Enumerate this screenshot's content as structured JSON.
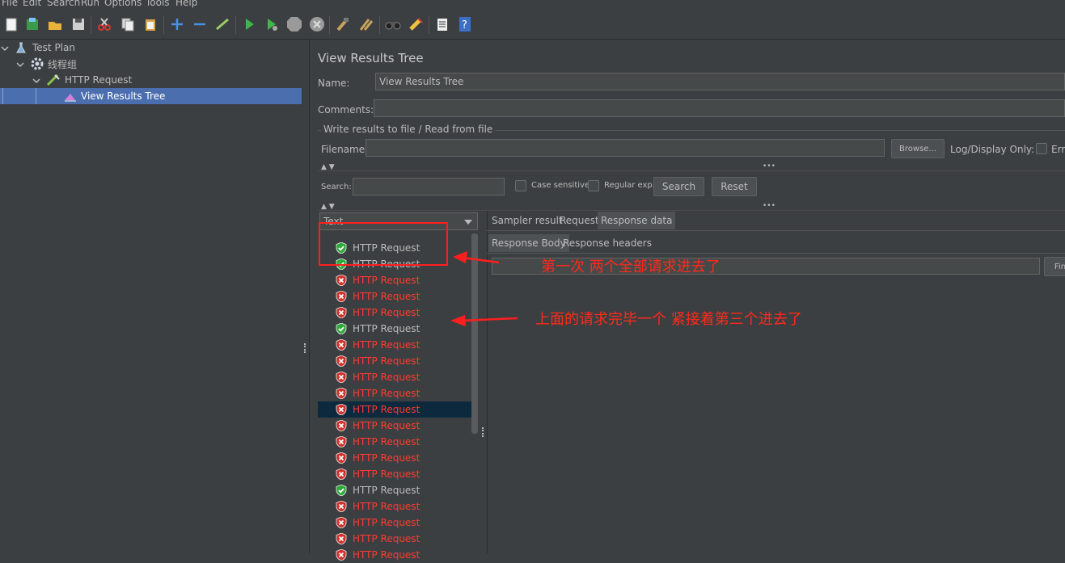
{
  "menu": [
    "File",
    "Edit",
    "Search",
    "Run",
    "Options",
    "Tools",
    "Help"
  ],
  "toolbar": {
    "icons": [
      "new-icon",
      "templates-icon",
      "open-icon",
      "save-icon",
      "cut-icon",
      "copy-icon",
      "paste-icon",
      "expand-icon",
      "collapse-icon",
      "toggle-icon",
      "start-icon",
      "start-no-pause-icon",
      "stop-icon",
      "shutdown-icon",
      "clear-icon",
      "clear-all-icon",
      "search-icon",
      "reset-search-icon",
      "function-helper-icon",
      "help-icon"
    ]
  },
  "tree": {
    "items": [
      {
        "label": "Test Plan",
        "icon": "flask-icon"
      },
      {
        "label": "线程组",
        "icon": "gear-icon"
      },
      {
        "label": "HTTP Request",
        "icon": "pipette-icon"
      },
      {
        "label": "View Results Tree",
        "icon": "chart-icon"
      }
    ]
  },
  "panel": {
    "title": "View Results Tree",
    "name_label": "Name:",
    "name_value": "View Results Tree",
    "comments_label": "Comments:",
    "comments_value": "",
    "file_group_label": "Write results to file / Read from file",
    "filename_label": "Filename",
    "filename_value": "",
    "browse_label": "Browse...",
    "log_display_label": "Log/Display Only:",
    "errors_label": "Erro",
    "search_label": "Search:",
    "search_value": "",
    "case_sensitive_label": "Case sensitive",
    "regular_exp_label": "Regular exp.",
    "search_button": "Search",
    "reset_button": "Reset",
    "renderer_selected": "Text",
    "tabs": [
      "Sampler result",
      "Request",
      "Response data"
    ],
    "subtabs": [
      "Response Body",
      "Response headers"
    ],
    "find_label": "Fin"
  },
  "results": [
    {
      "label": "HTTP Request",
      "status": "ok"
    },
    {
      "label": "HTTP Request",
      "status": "ok"
    },
    {
      "label": "HTTP Request",
      "status": "error"
    },
    {
      "label": "HTTP Request",
      "status": "error"
    },
    {
      "label": "HTTP Request",
      "status": "error"
    },
    {
      "label": "HTTP Request",
      "status": "ok"
    },
    {
      "label": "HTTP Request",
      "status": "error"
    },
    {
      "label": "HTTP Request",
      "status": "error"
    },
    {
      "label": "HTTP Request",
      "status": "error"
    },
    {
      "label": "HTTP Request",
      "status": "error"
    },
    {
      "label": "HTTP Request",
      "status": "error"
    },
    {
      "label": "HTTP Request",
      "status": "error"
    },
    {
      "label": "HTTP Request",
      "status": "error"
    },
    {
      "label": "HTTP Request",
      "status": "error"
    },
    {
      "label": "HTTP Request",
      "status": "error"
    },
    {
      "label": "HTTP Request",
      "status": "ok"
    },
    {
      "label": "HTTP Request",
      "status": "error"
    },
    {
      "label": "HTTP Request",
      "status": "error"
    },
    {
      "label": "HTTP Request",
      "status": "error"
    },
    {
      "label": "HTTP Request",
      "status": "error"
    }
  ],
  "annotations": {
    "first": "第一次 两个全部请求进去了",
    "second": "上面的请求完毕一个 紧接着第三个进去了"
  },
  "colors": {
    "accent_selection": "#4b6eaf",
    "error_text": "#ff3b30",
    "annotation": "#ff2a1a"
  }
}
